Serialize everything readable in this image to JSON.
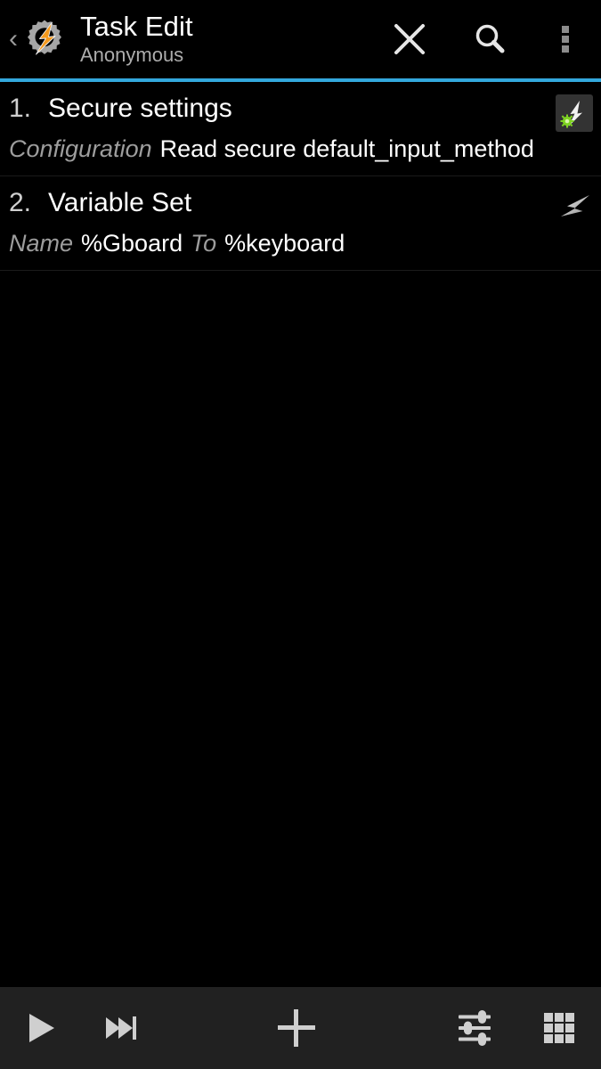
{
  "header": {
    "back_icon": "back-chevron-icon",
    "app_icon": "tasker-gear-bolt-icon",
    "title": "Task Edit",
    "subtitle": "Anonymous",
    "actions": [
      {
        "name": "close-button",
        "icon": "close-x-icon"
      },
      {
        "name": "search-button",
        "icon": "search-magnifier-icon"
      },
      {
        "name": "overflow-menu-button",
        "icon": "overflow-dots-icon"
      }
    ],
    "accent_color": "#33a8dd"
  },
  "actions": [
    {
      "number": "1.",
      "name": "Secure settings",
      "args": [
        {
          "label": "Configuration",
          "value": "Read secure default_input_method"
        }
      ],
      "icon": "plugin-bolt-android-icon"
    },
    {
      "number": "2.",
      "name": "Variable Set",
      "args": [
        {
          "label": "Name",
          "value": "%Gboard"
        },
        {
          "label": "To",
          "value": "%keyboard"
        }
      ],
      "icon": "bolt-icon"
    }
  ],
  "footer": {
    "buttons": [
      {
        "name": "run-task-button",
        "icon": "play-icon"
      },
      {
        "name": "step-task-button",
        "icon": "skip-next-icon"
      },
      {
        "name": "add-action-button",
        "icon": "plus-icon"
      },
      {
        "name": "task-properties-button",
        "icon": "sliders-icon"
      },
      {
        "name": "action-grid-button",
        "icon": "grid-icon"
      }
    ]
  }
}
